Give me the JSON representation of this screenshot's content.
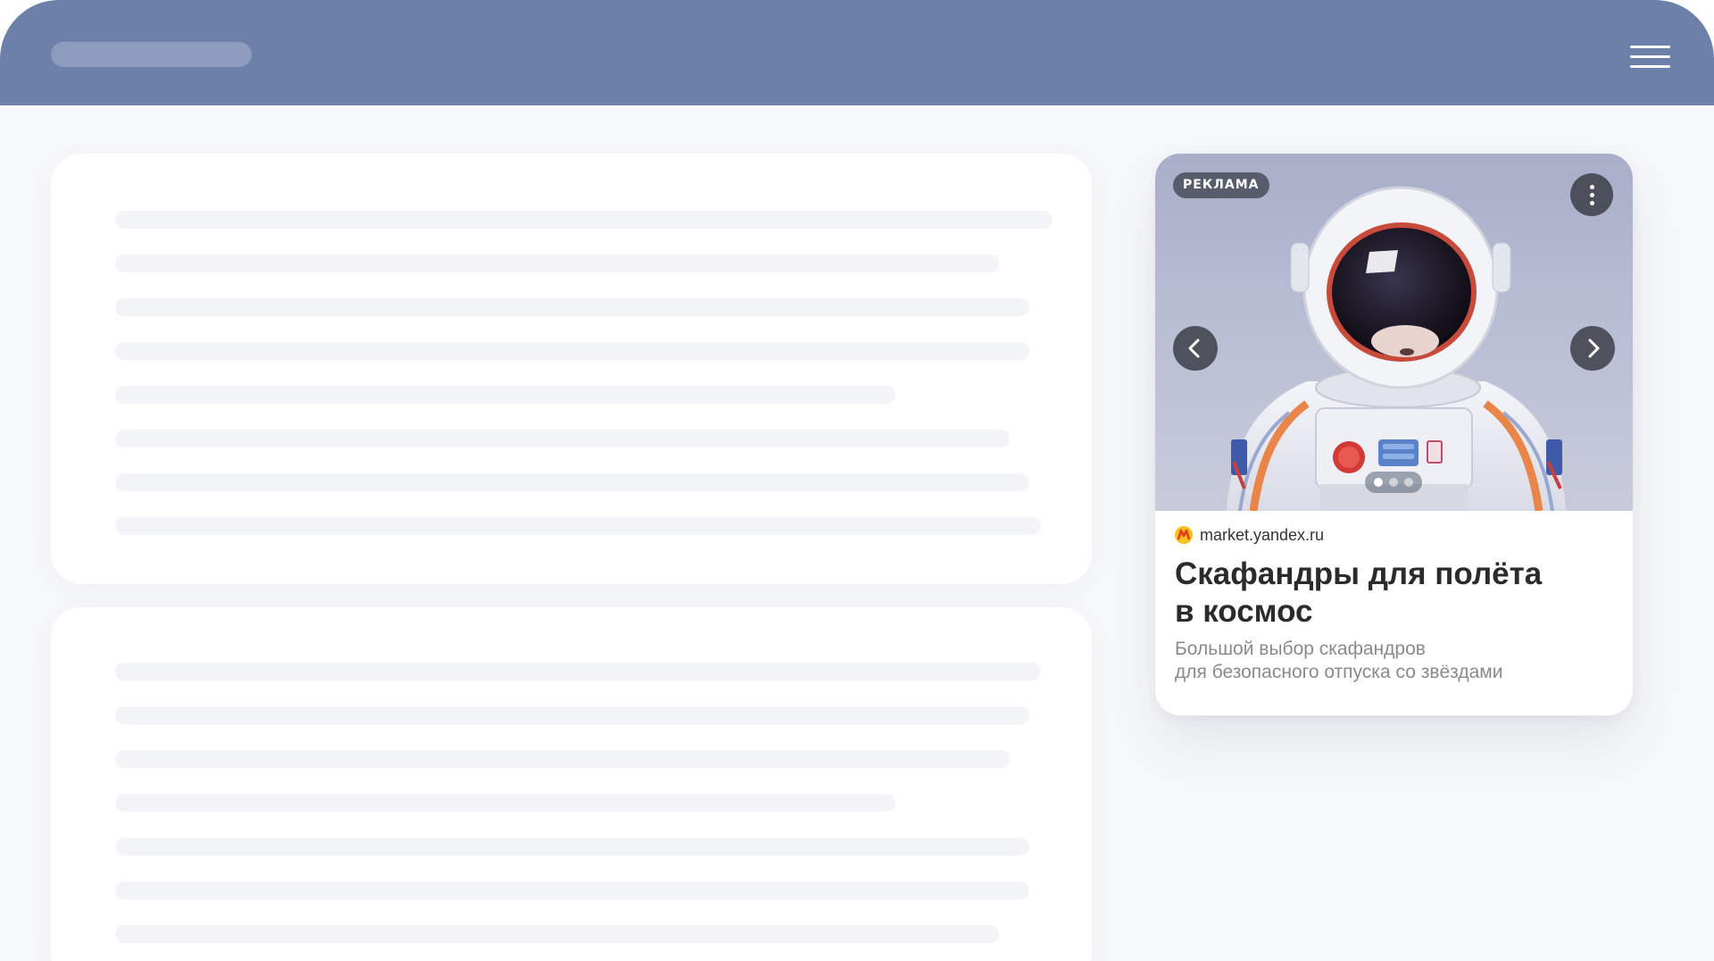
{
  "header": {
    "menu_icon": "hamburger-menu-icon",
    "accent_color": "#6d80aa"
  },
  "ad": {
    "badge": "РЕКЛАМА",
    "domain": "market.yandex.ru",
    "title_line1": "Скафандры для полёта",
    "title_line2": "в космос",
    "description_line1": "Большой выбор скафандров",
    "description_line2": "для безопасного отпуска со звёздами",
    "image": "astronaut-spacesuit-image",
    "carousel": {
      "slides": 3,
      "active_slide": 1,
      "prev_icon": "chevron-left-icon",
      "next_icon": "chevron-right-icon"
    },
    "more_icon": "more-vertical-icon",
    "favicon": "yandex-market-icon"
  }
}
